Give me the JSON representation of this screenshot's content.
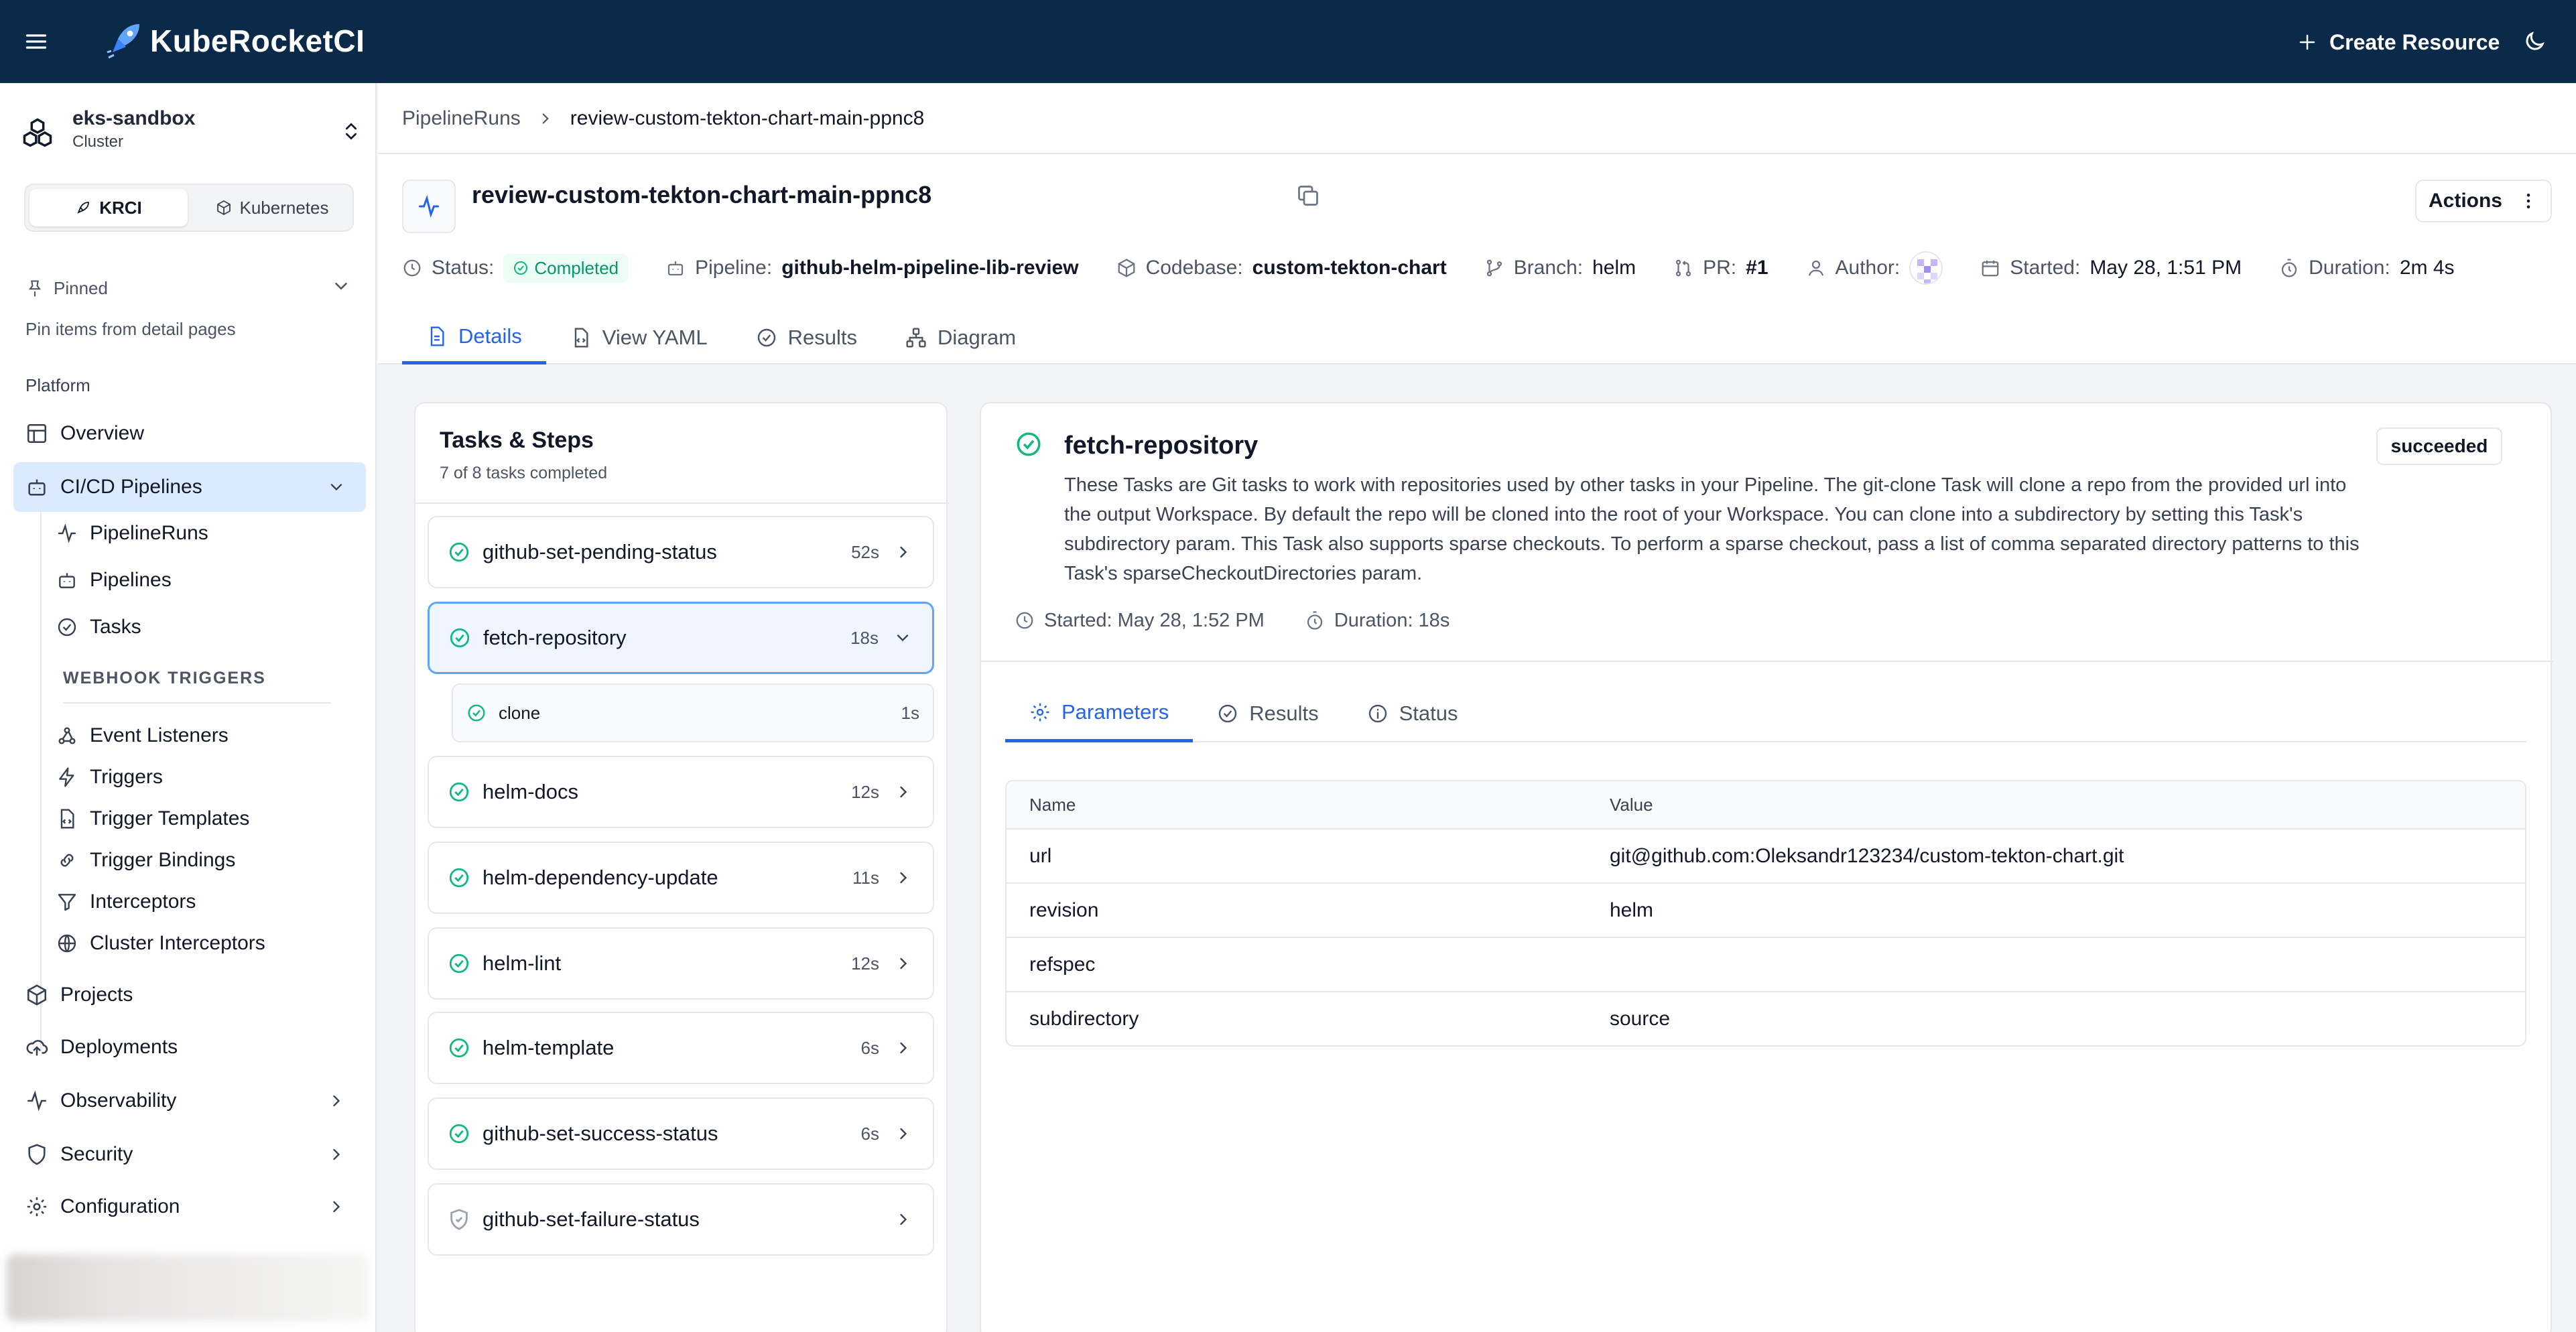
{
  "app": {
    "brand": "KubeRocketCI",
    "create_label": "Create Resource"
  },
  "cluster": {
    "name": "eks-sandbox",
    "type": "Cluster"
  },
  "mode_switch": {
    "krci": "KRCI",
    "kubernetes": "Kubernetes",
    "selected": "KRCI"
  },
  "pinned": {
    "label": "Pinned",
    "hint": "Pin items from detail pages"
  },
  "sidebar": {
    "section_platform": "Platform",
    "overview": "Overview",
    "cicd": "CI/CD Pipelines",
    "cicd_children": [
      "PipelineRuns",
      "Pipelines",
      "Tasks"
    ],
    "webhook_label": "WEBHOOK TRIGGERS",
    "webhook_children": [
      "Event Listeners",
      "Triggers",
      "Trigger Templates",
      "Trigger Bindings",
      "Interceptors",
      "Cluster Interceptors"
    ],
    "projects": "Projects",
    "deployments": "Deployments",
    "observability": "Observability",
    "security": "Security",
    "configuration": "Configuration"
  },
  "breadcrumb": {
    "parent": "PipelineRuns",
    "current": "review-custom-tekton-chart-main-ppnc8"
  },
  "header": {
    "title": "review-custom-tekton-chart-main-ppnc8",
    "actions_label": "Actions",
    "status_label": "Status:",
    "status_value": "Completed",
    "pipeline_label": "Pipeline:",
    "pipeline_value": "github-helm-pipeline-lib-review",
    "codebase_label": "Codebase:",
    "codebase_value": "custom-tekton-chart",
    "branch_label": "Branch:",
    "branch_value": "helm",
    "pr_label": "PR:",
    "pr_value": "#1",
    "author_label": "Author:",
    "started_label": "Started:",
    "started_value": "May 28, 1:51 PM",
    "duration_label": "Duration:",
    "duration_value": "2m 4s"
  },
  "tabs": [
    "Details",
    "View YAML",
    "Results",
    "Diagram"
  ],
  "tasks": {
    "title": "Tasks & Steps",
    "subtitle": "7 of 8 tasks completed",
    "items": [
      {
        "name": "github-set-pending-status",
        "duration": "52s"
      },
      {
        "name": "fetch-repository",
        "duration": "18s"
      },
      {
        "name": "helm-docs",
        "duration": "12s"
      },
      {
        "name": "helm-dependency-update",
        "duration": "11s"
      },
      {
        "name": "helm-lint",
        "duration": "12s"
      },
      {
        "name": "helm-template",
        "duration": "6s"
      },
      {
        "name": "github-set-success-status",
        "duration": "6s"
      },
      {
        "name": "github-set-failure-status",
        "duration": ""
      }
    ],
    "step": {
      "name": "clone",
      "duration": "1s"
    }
  },
  "detail": {
    "title": "fetch-repository",
    "badge": "succeeded",
    "description": "These Tasks are Git tasks to work with repositories used by other tasks in your Pipeline. The git-clone Task will clone a repo from the provided url into the output Workspace. By default the repo will be cloned into the root of your Workspace. You can clone into a subdirectory by setting this Task's subdirectory param. This Task also supports sparse checkouts. To perform a sparse checkout, pass a list of comma separated directory patterns to this Task's sparseCheckoutDirectories param.",
    "started": "Started: May 28, 1:52 PM",
    "duration": "Duration: 18s",
    "tabs": [
      "Parameters",
      "Results",
      "Status"
    ],
    "table": {
      "headers": [
        "Name",
        "Value"
      ],
      "rows": [
        {
          "name": "url",
          "value": "git@github.com:Oleksandr123234/custom-tekton-chart.git"
        },
        {
          "name": "revision",
          "value": "helm"
        },
        {
          "name": "refspec",
          "value": ""
        },
        {
          "name": "subdirectory",
          "value": "source"
        }
      ]
    }
  }
}
